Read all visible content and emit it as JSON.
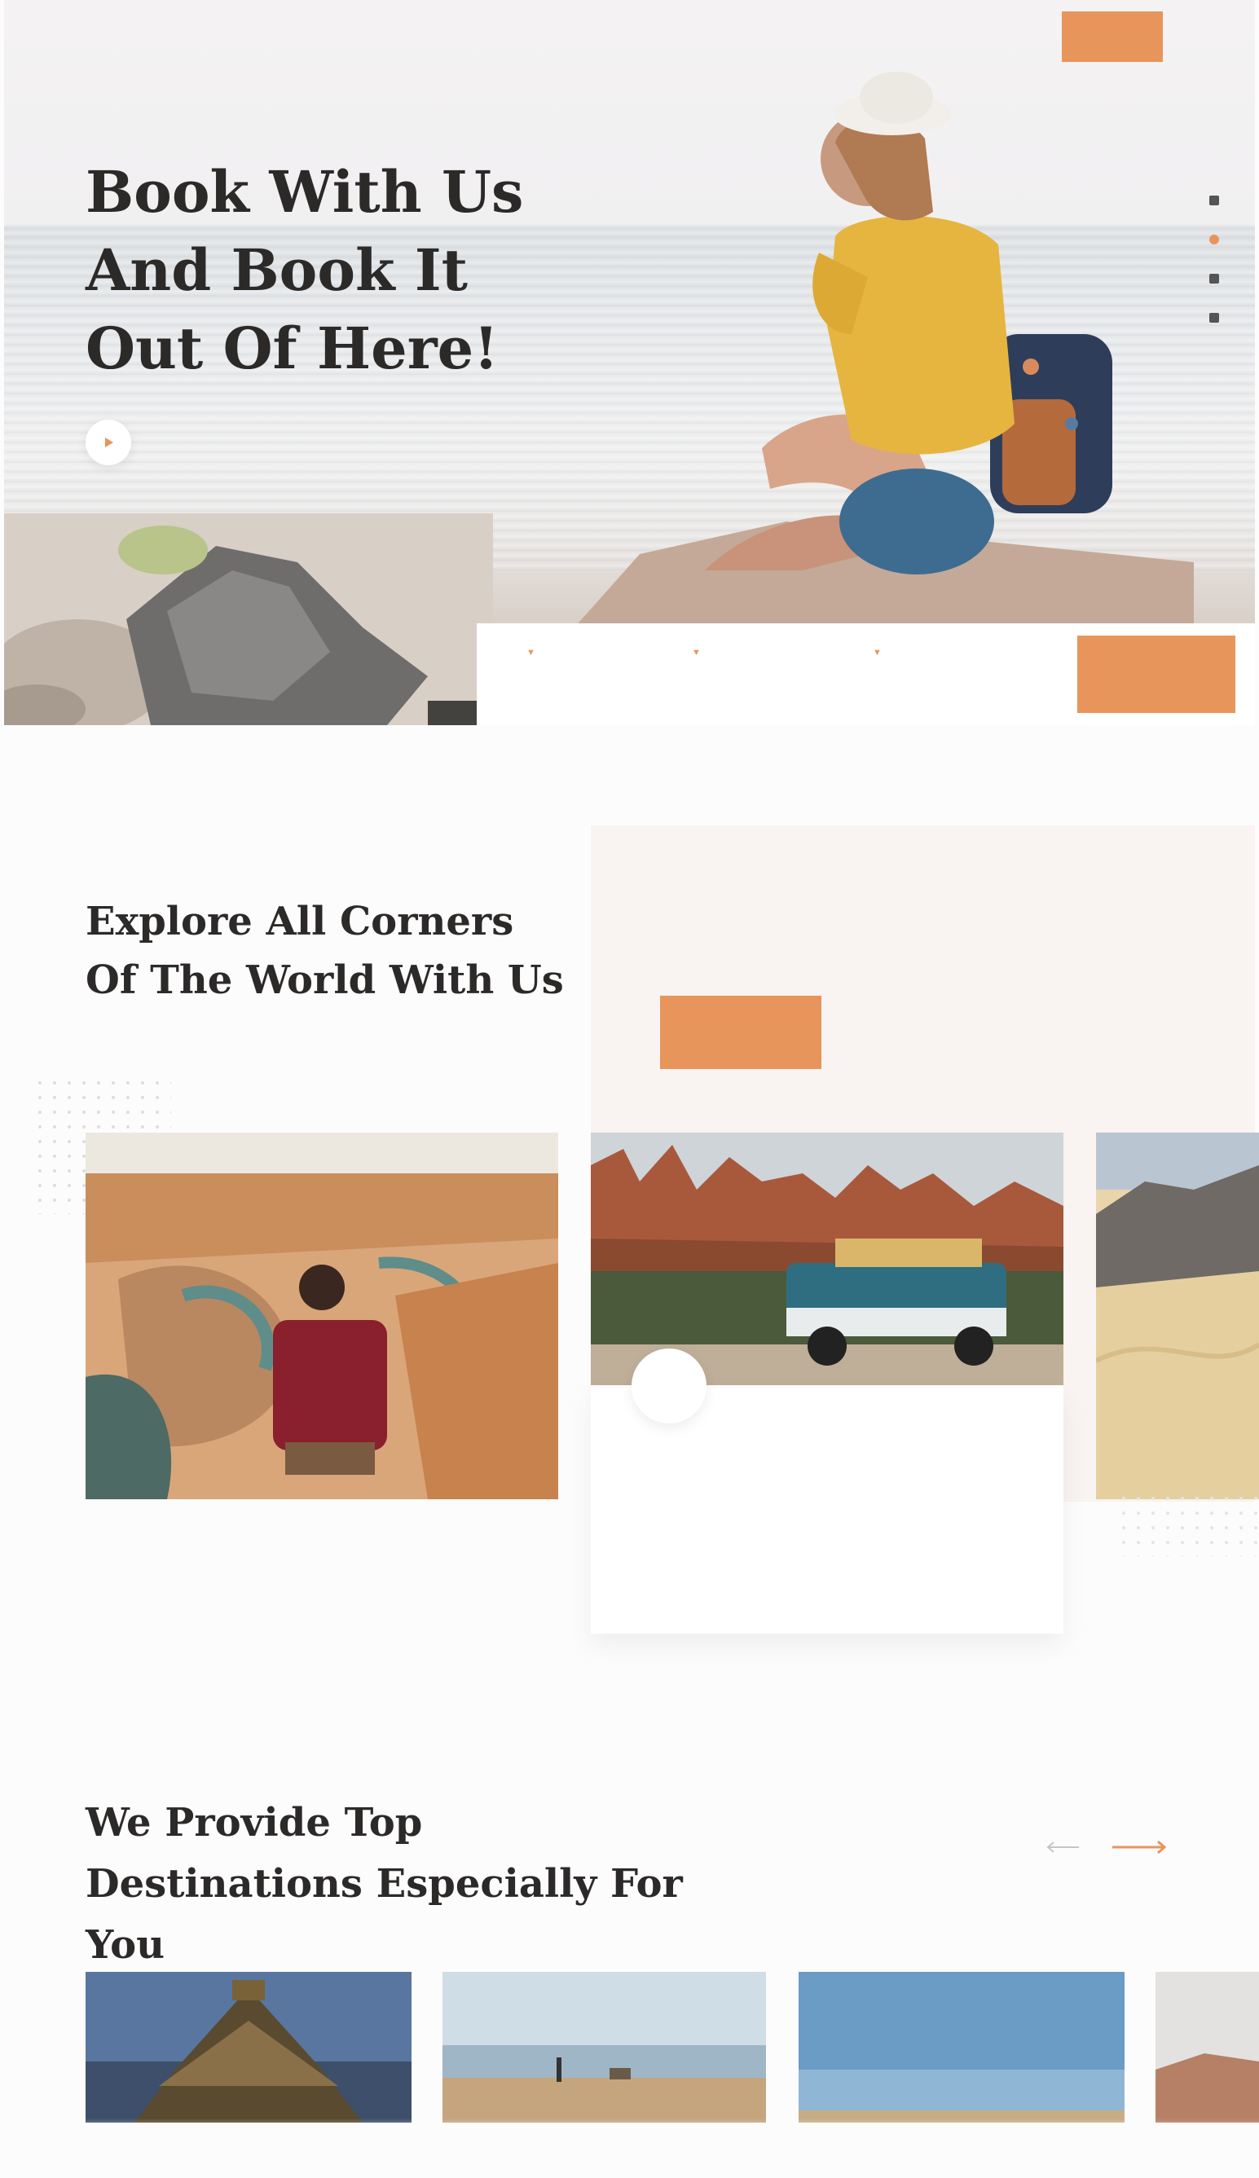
{
  "nav": {
    "logo": "",
    "links": [
      "",
      "",
      "",
      "",
      ""
    ],
    "login_label": ""
  },
  "hero": {
    "title": "Book With Us And Book It Out Of Here!",
    "video_label": ""
  },
  "search": {
    "location_label": "",
    "location_value": "",
    "date_label": "",
    "date_value": "",
    "price_label": "",
    "price_value": "",
    "button_label": ""
  },
  "about": {
    "label": "",
    "title": "Explore All Corners Of The World With Us",
    "text": "",
    "button_label": ""
  },
  "card": {
    "badge": "",
    "title": "",
    "text": ""
  },
  "destinations": {
    "label": "",
    "title": "We Provide Top Destinations Especially For You"
  },
  "colors": {
    "accent": "#e8955c",
    "panel": "#f9f3f1",
    "heading": "#2c2a29"
  },
  "icons": {
    "video": "play-icon",
    "social": [
      "social-icon",
      "social-icon",
      "social-icon",
      "social-icon"
    ],
    "prev": "arrow-left-icon",
    "next": "arrow-right-icon"
  }
}
